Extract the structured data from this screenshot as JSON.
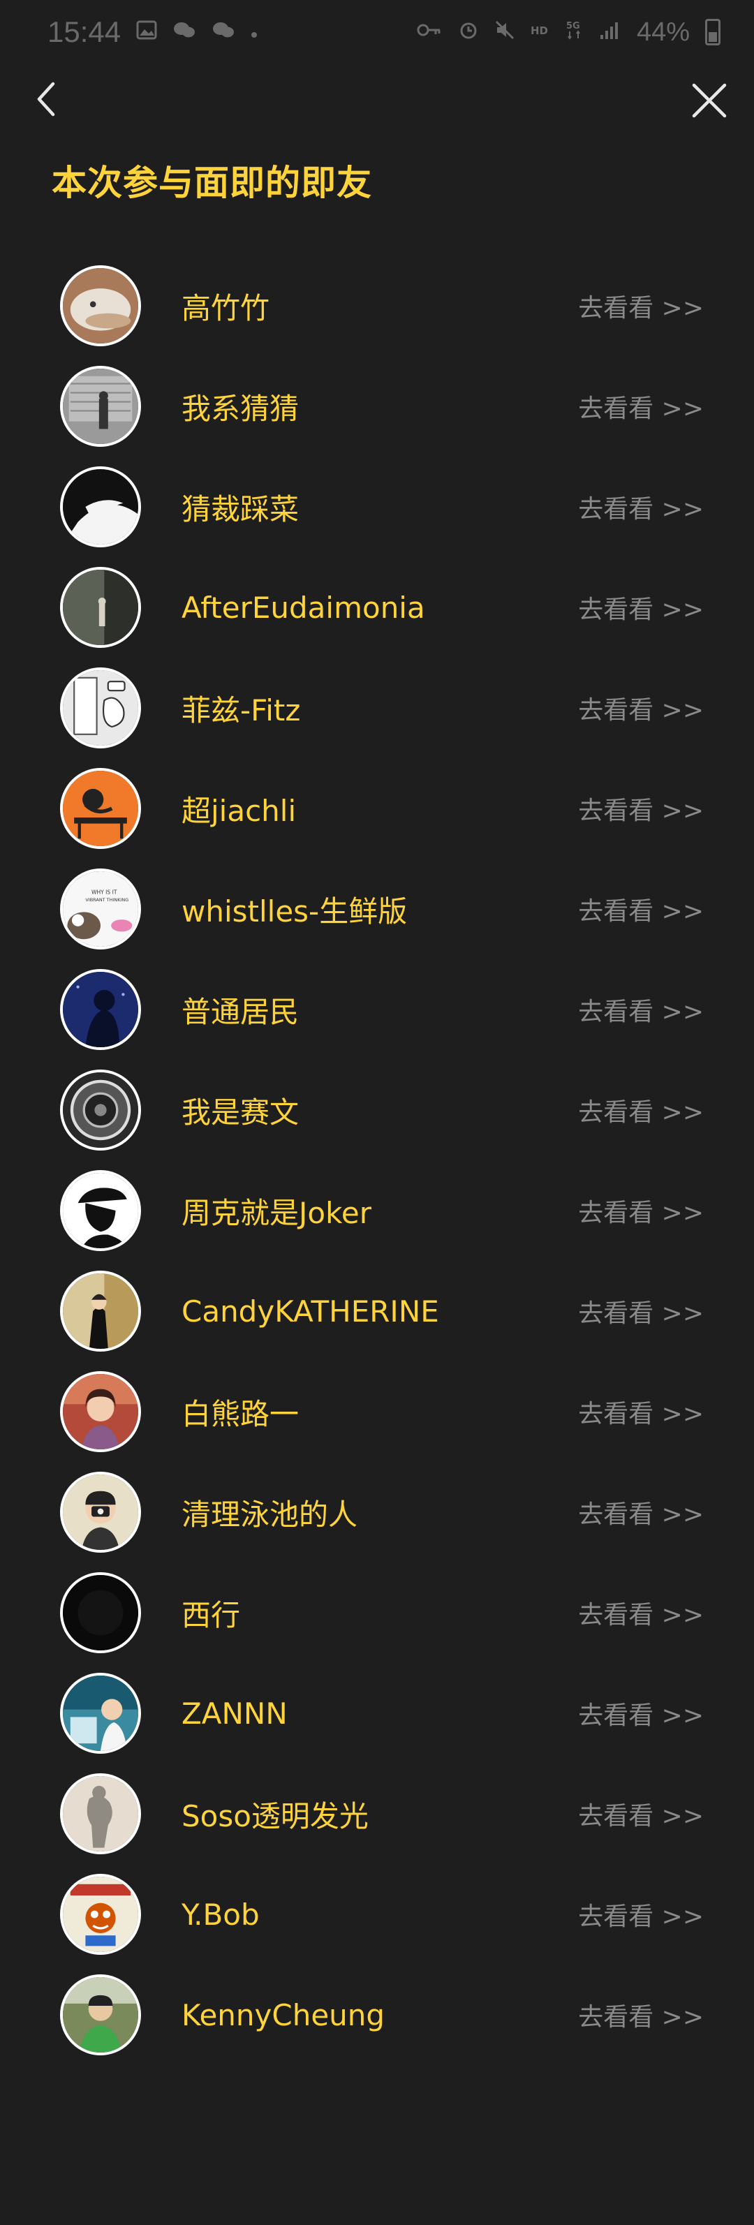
{
  "status_bar": {
    "time": "15:44",
    "battery": "44%",
    "battery_level": 0.44,
    "icons": [
      "image-icon",
      "wechat-icon",
      "wechat-icon",
      "dot-icon",
      "key-icon",
      "alarm-icon",
      "mute-icon",
      "hd-icon",
      "5g-icon",
      "signal-icon",
      "battery-icon"
    ]
  },
  "nav": {
    "back_icon": "chevron-left-icon",
    "close_icon": "close-icon"
  },
  "title": "本次参与面即的即友",
  "link_label": "去看看 >>",
  "colors": {
    "background": "#1e1e1e",
    "accent": "#ffd43b",
    "muted": "#8a8a8a"
  },
  "users": [
    {
      "name": "高竹竹"
    },
    {
      "name": "我系猜猜"
    },
    {
      "name": "猜裁踩菜"
    },
    {
      "name": "AfterEudaimonia"
    },
    {
      "name": "菲兹-Fitz"
    },
    {
      "name": "超jiachli"
    },
    {
      "name": "whistlles-生鲜版"
    },
    {
      "name": "普通居民"
    },
    {
      "name": "我是赛文"
    },
    {
      "name": "周克就是Joker"
    },
    {
      "name": "CandyKATHERINE"
    },
    {
      "name": "白熊路一"
    },
    {
      "name": "清理泳池的人"
    },
    {
      "name": "西行"
    },
    {
      "name": "ZANNN"
    },
    {
      "name": "Soso透明发光"
    },
    {
      "name": "Y.Bob"
    },
    {
      "name": "KennyCheung"
    }
  ]
}
